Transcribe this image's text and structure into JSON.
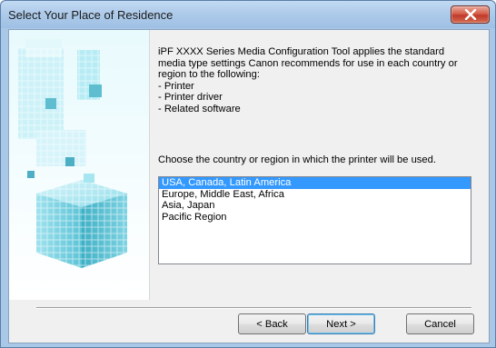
{
  "window": {
    "title": "Select Your Place of Residence",
    "close_icon": "close-icon"
  },
  "content": {
    "intro": "iPF XXXX  Series Media Configuration Tool applies the standard\nmedia type settings Canon recommends for use in each country or\nregion to the following:\n- Printer\n- Printer driver\n- Related software",
    "prompt": "Choose the country or region in which the printer will be used.",
    "regions": [
      {
        "label": "USA, Canada, Latin America",
        "selected": true
      },
      {
        "label": "Europe, Middle East, Africa",
        "selected": false
      },
      {
        "label": "Asia, Japan",
        "selected": false
      },
      {
        "label": "Pacific Region",
        "selected": false
      }
    ]
  },
  "buttons": {
    "back": "< Back",
    "next": "Next >",
    "cancel": "Cancel"
  },
  "colors": {
    "selection": "#3399ff",
    "cube_light": "#bfeff7",
    "cube_dark": "#3bb3c9"
  },
  "side_image_icon": "cube-graphic-icon"
}
